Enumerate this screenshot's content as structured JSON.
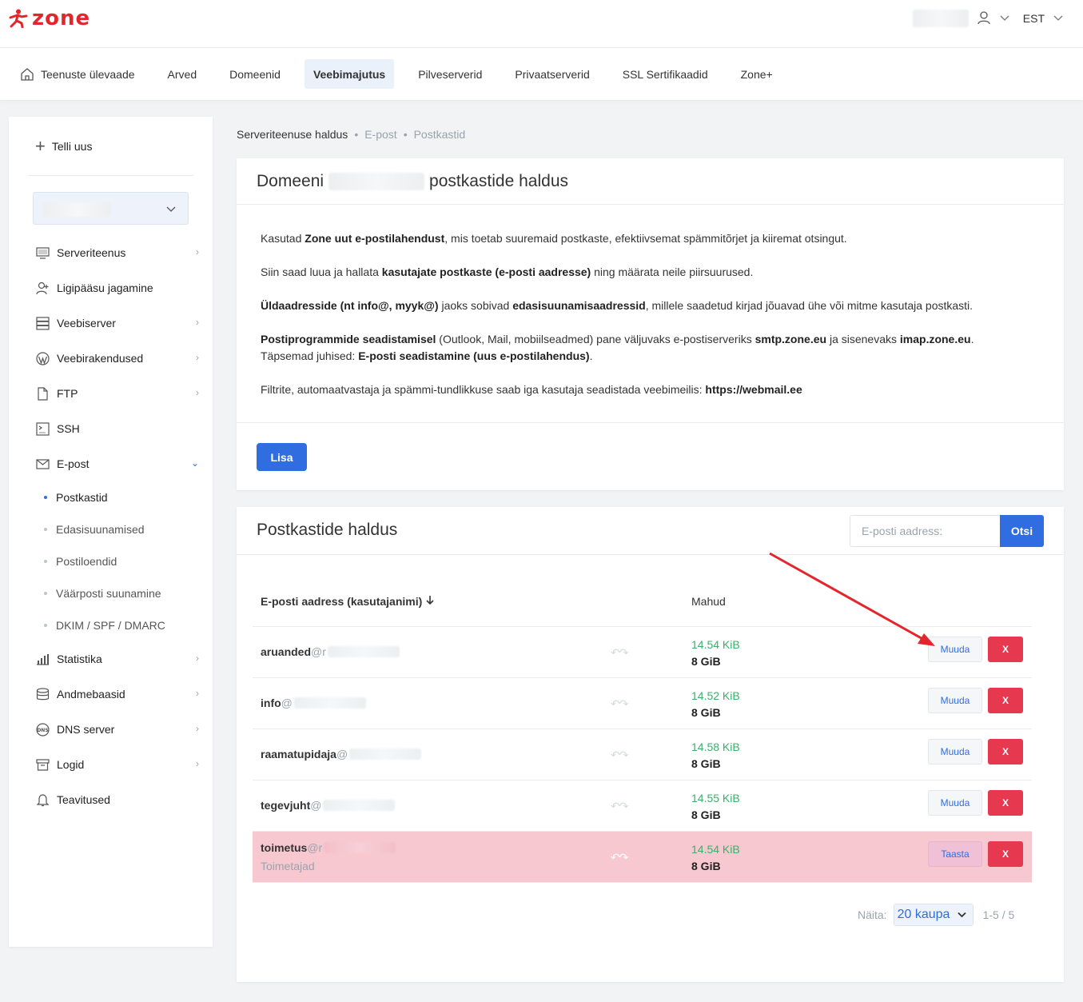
{
  "app": {
    "logo_text": "zone",
    "language": "EST"
  },
  "mainnav": [
    {
      "label": "Teenuste ülevaade",
      "active": false
    },
    {
      "label": "Arved",
      "active": false
    },
    {
      "label": "Domeenid",
      "active": false
    },
    {
      "label": "Veebimajutus",
      "active": true
    },
    {
      "label": "Pilveserverid",
      "active": false
    },
    {
      "label": "Privaatserverid",
      "active": false
    },
    {
      "label": "SSL Sertifikaadid",
      "active": false
    },
    {
      "label": "Zone+",
      "active": false
    }
  ],
  "sidebar": {
    "add_new": "Telli uus",
    "items": [
      {
        "label": "Serveriteenus",
        "icon": "monitor-icon"
      },
      {
        "label": "Ligipääsu jagamine",
        "icon": "user-icon"
      },
      {
        "label": "Veebiserver",
        "icon": "server-icon"
      },
      {
        "label": "Veebirakendused",
        "icon": "wordpress-icon"
      },
      {
        "label": "FTP",
        "icon": "file-icon"
      },
      {
        "label": "SSH",
        "icon": "terminal-icon"
      },
      {
        "label": "E-post",
        "icon": "mail-icon"
      },
      {
        "label": "Statistika",
        "icon": "chart-icon"
      },
      {
        "label": "Andmebaasid",
        "icon": "database-icon"
      },
      {
        "label": "DNS server",
        "icon": "dns-icon"
      },
      {
        "label": "Logid",
        "icon": "archive-icon"
      },
      {
        "label": "Teavitused",
        "icon": "bell-icon"
      }
    ],
    "email_sub": [
      "Postkastid",
      "Edasisuunamised",
      "Postiloendid",
      "Väärposti suunamine",
      "DKIM / SPF / DMARC"
    ]
  },
  "breadcrumb": {
    "b1": "Serveriteenuse haldus",
    "b2": "E-post",
    "b3": "Postkastid",
    "sep": "•"
  },
  "card1": {
    "title_pre": "Domeeni",
    "title_post": "postkastide haldus",
    "p1": [
      "Kasutad ",
      "Zone uut e-postilahendust",
      ", mis toetab suuremaid postkaste, efektiivsemat spämmitõrjet ja kiiremat otsingut."
    ],
    "p2": [
      "Siin saad luua ja hallata ",
      "kasutajate postkaste (e-posti aadresse)",
      " ning määrata neile piirsuurused."
    ],
    "p3": [
      "Üldaadresside (nt info@, myyk@)",
      " jaoks sobivad ",
      "edasisuunamisaadressid",
      ", millele saadetud kirjad jõuavad ühe või mitme kasutaja postkasti."
    ],
    "p4": [
      "Postiprogrammide seadistamisel",
      " (Outlook, Mail, mobiilseadmed) pane väljuvaks e-postiserveriks ",
      "smtp.zone.eu",
      " ja sisenevaks ",
      "imap.zone.eu",
      ". Täpsemad juhised: ",
      "E-posti seadistamine (uus e-postilahendus)",
      "."
    ],
    "p5": [
      "Filtrite, automaatvastaja ja spämmi-tundlikkuse saab iga kasutaja seadistada veebimeilis: ",
      "https://webmail.ee"
    ],
    "add_button": "Lisa"
  },
  "card2": {
    "title": "Postkastide haldus",
    "search_placeholder": "E-posti aadress:",
    "search_button": "Otsi",
    "col_email": "E-posti aadress (kasutajanimi)",
    "col_size": "Mahud",
    "rows": [
      {
        "user": "aruanded",
        "at": "@r",
        "used": "14.54 KiB",
        "quota": "8 GiB",
        "action": "Muuda",
        "deleted": false,
        "sub": ""
      },
      {
        "user": "info",
        "at": "@",
        "used": "14.52 KiB",
        "quota": "8 GiB",
        "action": "Muuda",
        "deleted": false,
        "sub": ""
      },
      {
        "user": "raamatupidaja",
        "at": "@",
        "used": "14.58 KiB",
        "quota": "8 GiB",
        "action": "Muuda",
        "deleted": false,
        "sub": ""
      },
      {
        "user": "tegevjuht",
        "at": "@",
        "used": "14.55 KiB",
        "quota": "8 GiB",
        "action": "Muuda",
        "deleted": false,
        "sub": ""
      },
      {
        "user": "toimetus",
        "at": "@r",
        "used": "14.54 KiB",
        "quota": "8 GiB",
        "action": "Taasta",
        "deleted": true,
        "sub": "Toimetajad"
      }
    ],
    "delete_label": "X",
    "pager": {
      "label": "Näita:",
      "per_page": "20 kaupa",
      "range": "1-5 / 5"
    }
  },
  "colors": {
    "accent": "#2f6de0",
    "brand": "#e3262e",
    "danger": "#e63950",
    "deleted_row": "#f8c8d0",
    "usage": "#3ab06a"
  }
}
